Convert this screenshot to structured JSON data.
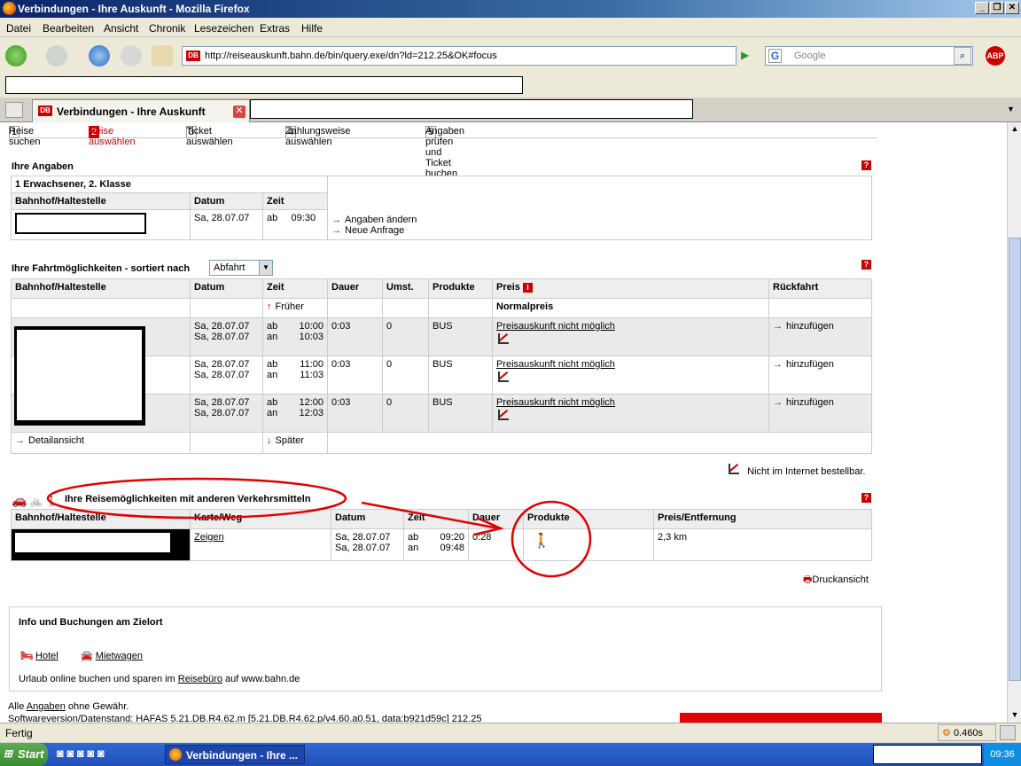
{
  "window": {
    "title": "Verbindungen - Ihre Auskunft - Mozilla Firefox"
  },
  "menu": [
    "Datei",
    "Bearbeiten",
    "Ansicht",
    "Chronik",
    "Lesezeichen",
    "Extras",
    "Hilfe"
  ],
  "nav": {
    "url": "http://reiseauskunft.bahn.de/bin/query.exe/dn?ld=212.25&OK#focus",
    "search_placeholder": "Google",
    "db_label": "DB",
    "abp_label": "ABP"
  },
  "tab": {
    "title": "Verbindungen - Ihre Auskunft",
    "db_label": "DB"
  },
  "steps": [
    {
      "n": "1",
      "label": "Reise suchen"
    },
    {
      "n": "2",
      "label": "Reise auswählen"
    },
    {
      "n": "3",
      "label": "Ticket auswählen"
    },
    {
      "n": "4",
      "label": "Zahlungsweise auswählen"
    },
    {
      "n": "5",
      "label": "Angaben prüfen und Ticket buchen"
    }
  ],
  "angaben": {
    "heading": "Ihre Angaben",
    "passenger": "1 Erwachsener, 2. Klasse",
    "col_station": "Bahnhof/Haltestelle",
    "col_date": "Datum",
    "col_time": "Zeit",
    "date": "Sa,  28.07.07",
    "time_prefix": "ab",
    "time": "09:30",
    "link_change": "Angaben ändern",
    "link_new": "Neue Anfrage"
  },
  "fahrt": {
    "heading": "Ihre Fahrtmöglichkeiten  - sortiert nach",
    "sort_value": "Abfahrt",
    "headers": [
      "Bahnhof/Haltestelle",
      "Datum",
      "Zeit",
      "Dauer",
      "Umst.",
      "Produkte",
      "Preis",
      "Rückfahrt"
    ],
    "earlier": "Früher",
    "later": "Später",
    "normalpreis": "Normalpreis",
    "detail": "Detailansicht",
    "rows": [
      {
        "date1": "Sa, 28.07.07",
        "date2": "Sa, 28.07.07",
        "ab": "ab",
        "an": "an",
        "t1": "10:00",
        "t2": "10:03",
        "dauer": "0:03",
        "umst": "0",
        "prod": "BUS",
        "preis": "Preisauskunft nicht möglich",
        "rueck": "hinzufügen"
      },
      {
        "date1": "Sa, 28.07.07",
        "date2": "Sa, 28.07.07",
        "ab": "ab",
        "an": "an",
        "t1": "11:00",
        "t2": "11:03",
        "dauer": "0:03",
        "umst": "0",
        "prod": "BUS",
        "preis": "Preisauskunft nicht möglich",
        "rueck": "hinzufügen"
      },
      {
        "date1": "Sa, 28.07.07",
        "date2": "Sa, 28.07.07",
        "ab": "ab",
        "an": "an",
        "t1": "12:00",
        "t2": "12:03",
        "dauer": "0:03",
        "umst": "0",
        "prod": "BUS",
        "preis": "Preisauskunft nicht möglich",
        "rueck": "hinzufügen"
      }
    ],
    "legend": "Nicht im Internet bestellbar."
  },
  "andere": {
    "heading": "Ihre Reisemöglichkeiten mit anderen Verkehrsmitteln",
    "headers": [
      "Bahnhof/Haltestelle",
      "Karte/Weg",
      "Datum",
      "Zeit",
      "Dauer",
      "Produkte",
      "Preis/Entfernung"
    ],
    "link": "Zeigen",
    "date1": "Sa, 28.07.07",
    "date2": "Sa, 28.07.07",
    "ab": "ab",
    "an": "an",
    "t1": "09:20",
    "t2": "09:48",
    "dauer": "0:28",
    "entfernung": "2,3 km"
  },
  "druck": "Druckansicht",
  "info": {
    "heading": "Info und Buchungen am Zielort",
    "hotel": "Hotel",
    "mietwagen": "Mietwagen",
    "text_pre": "Urlaub online buchen und sparen im",
    "text_link": "Reisebüro",
    "text_post": "auf www.bahn.de"
  },
  "footer": {
    "line1_pre": "Alle",
    "line1_link": "Angaben",
    "line1_post": "ohne Gewähr.",
    "line2": "Softwareversion/Datenstand: HAFAS 5.21.DB.R4.62.m [5.21.DB.R4.62.p/v4.60.a0.51, data:b921d59c] 212.25"
  },
  "status": {
    "left": "Fertig",
    "timer": "0.460s"
  },
  "taskbar": {
    "start": "Start",
    "item": "Verbindungen - Ihre ...",
    "clock": "09:36"
  }
}
